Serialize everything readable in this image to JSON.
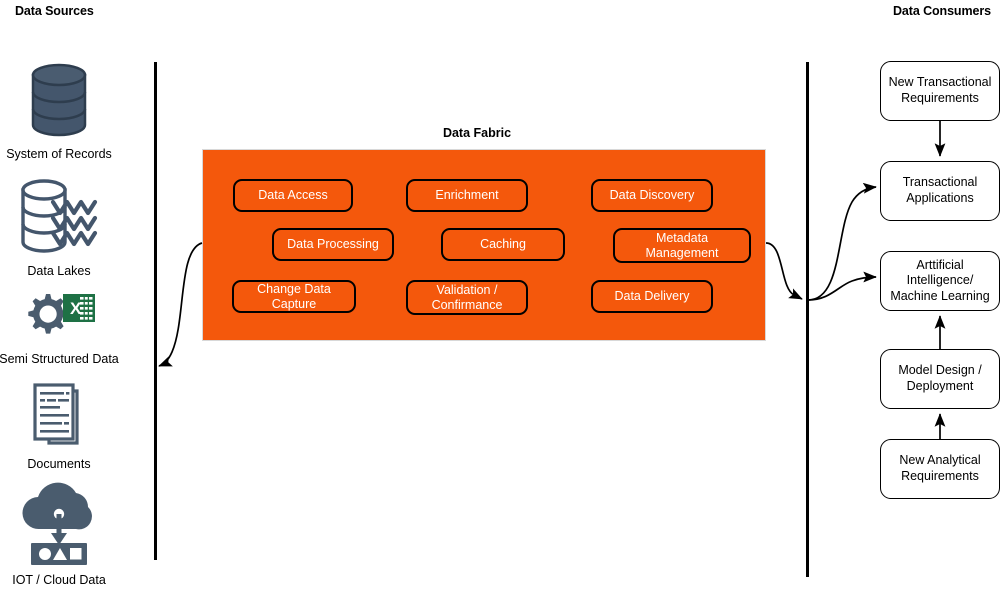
{
  "headers": {
    "left": "Data Sources",
    "right": "Data Consumers"
  },
  "fabric": {
    "title": "Data Fabric",
    "color": "#F4580C",
    "capabilities": [
      {
        "label": "Data Access",
        "icon": "rounded-box"
      },
      {
        "label": "Enrichment",
        "icon": "rounded-box"
      },
      {
        "label": "Data Discovery",
        "icon": "rounded-box"
      },
      {
        "label": "Data Processing",
        "icon": "rounded-box"
      },
      {
        "label": "Caching",
        "icon": "rounded-box"
      },
      {
        "label": "Metadata Management",
        "icon": "rounded-box"
      },
      {
        "label": "Change Data Capture",
        "icon": "rounded-box"
      },
      {
        "label": "Validation / Confirmance",
        "icon": "rounded-box"
      },
      {
        "label": "Data Delivery",
        "icon": "rounded-box"
      }
    ]
  },
  "sources": [
    {
      "label": "System of Records",
      "icon": "database-icon",
      "color": "#44566C"
    },
    {
      "label": "Data Lakes",
      "icon": "data-lake-icon",
      "color": "#44566C"
    },
    {
      "label": "Semi Structured Data",
      "icon": "gear-spreadsheet-icon",
      "color": "#44566C",
      "accent": "#1E7145"
    },
    {
      "label": "Documents",
      "icon": "documents-icon",
      "color": "#4A5C6E"
    },
    {
      "label": "IOT / Cloud Data",
      "icon": "cloud-download-icon",
      "color": "#44566C"
    }
  ],
  "consumers": [
    {
      "label": "New Transactional Requirements"
    },
    {
      "label": "Transactional Applications"
    },
    {
      "label": "Arttificial Intelligence/ Machine Learning"
    },
    {
      "label": "Model Design / Deployment"
    },
    {
      "label": "New Analytical Requirements"
    }
  ]
}
